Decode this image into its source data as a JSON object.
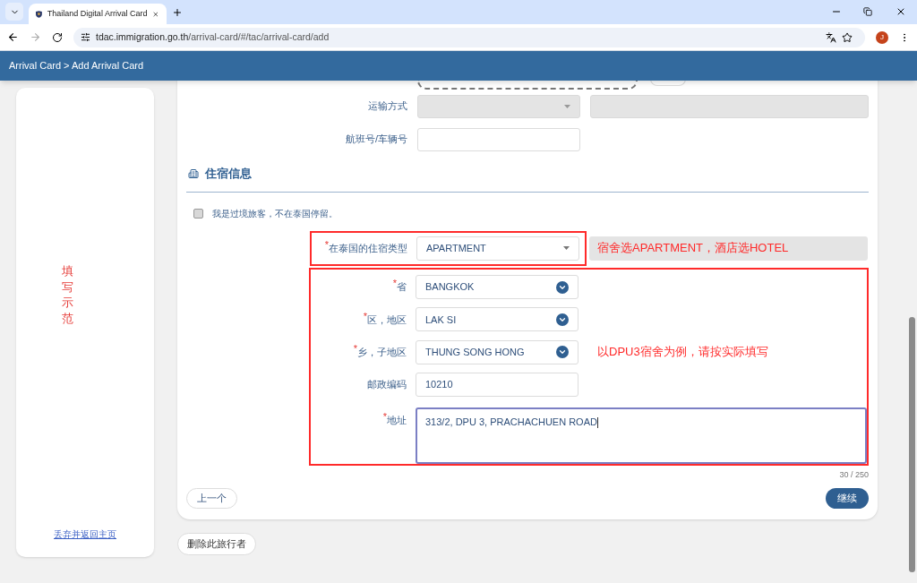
{
  "browser": {
    "tab_title": "Thailand Digital Arrival Card",
    "url_host": "tdac.immigration.go.th",
    "url_path": "/arrival-card/#/tac/arrival-card/add",
    "profile_initial": "J"
  },
  "header": {
    "breadcrumb": "Arrival Card > Add Arrival Card"
  },
  "sidebar": {
    "vertical_label": "填写示范",
    "link": "丢弃并返回主页"
  },
  "transport": [
    {
      "label": "运输方式",
      "kind": "select_pair"
    },
    {
      "label": "航班号/车辆号",
      "kind": "input"
    }
  ],
  "accommodation": {
    "section_title": "住宿信息",
    "transit": {
      "label": "我是过境旅客，不在泰国停留。",
      "checked": false
    },
    "type": {
      "label": "在泰国的住宿类型",
      "required_mark": "*",
      "value": "APARTMENT"
    },
    "type_note": "宿舍选APARTMENT，酒店选HOTEL",
    "fields": [
      {
        "label": "省",
        "required_mark": "*",
        "value": "BANGKOK",
        "kind": "select"
      },
      {
        "label": "区，地区",
        "required_mark": "*",
        "value": "LAK SI",
        "kind": "select"
      },
      {
        "label": "乡，子地区",
        "required_mark": "*",
        "value": "THUNG SONG HONG",
        "kind": "select",
        "note": "以DPU3宿舍为例，请按实际填写"
      },
      {
        "label": "邮政编码",
        "value": "10210",
        "kind": "input"
      },
      {
        "label": "地址",
        "required_mark": "*",
        "value": "313/2, DPU 3, PRACHACHUEN ROAD",
        "kind": "textarea"
      }
    ],
    "char_count": "30 / 250"
  },
  "buttons": {
    "back": "上一个",
    "continue": "继续",
    "delete": "删除此旅行者"
  }
}
